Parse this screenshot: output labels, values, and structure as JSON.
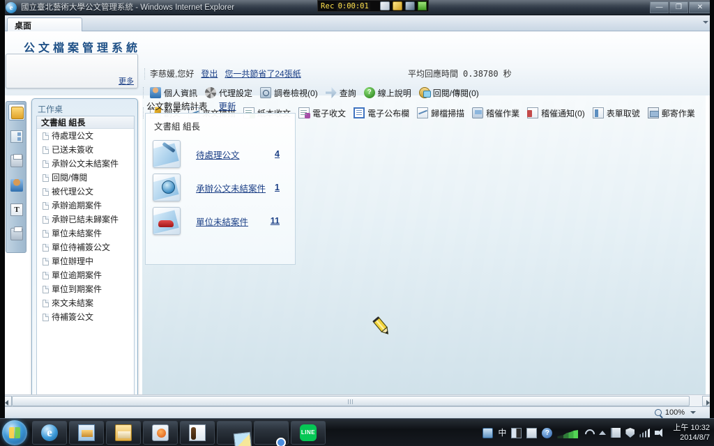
{
  "window": {
    "title": "國立臺北藝術大學公文管理系統 - Windows Internet Explorer",
    "browser_icon": "ie-logo-icon",
    "minimize_label": "—",
    "maximize_label": "❐",
    "close_label": "✕"
  },
  "recorder": {
    "label": "Rec",
    "time": "0:00:01",
    "tools": [
      "pen-tool-icon",
      "highlighter-tool-icon",
      "spray-tool-icon",
      "stop-record-icon"
    ]
  },
  "tabstrip": {
    "tab_label": "桌面"
  },
  "app_header": {
    "brand": "公文檔案管理系統",
    "greeting": "李慈媛,您好",
    "logout_label": "登出",
    "paper_saved": "您一共節省了24張紙",
    "response_label": "平均回應時間",
    "response_value": "0.38780",
    "response_unit": "秒"
  },
  "announcement": {
    "more_label": "更多"
  },
  "toolbar_row1": [
    {
      "label": "個人資訊",
      "icon": "person-icon"
    },
    {
      "label": "代理設定",
      "icon": "gear-icon"
    },
    {
      "label": "調卷檢視(0)",
      "icon": "magnifier-icon"
    },
    {
      "label": "查詢",
      "icon": "find-icon"
    },
    {
      "label": "線上說明",
      "icon": "help-circle-icon"
    },
    {
      "label": "回閱/傳閱(0)",
      "icon": "circulate-icon"
    }
  ],
  "toolbar_row2": [
    {
      "label": "創文",
      "icon": "compose-icon"
    },
    {
      "label": "來文掃描",
      "icon": "scan-incoming-icon"
    },
    {
      "label": "紙本收文",
      "icon": "paper-receive-icon"
    },
    {
      "label": "電子收文",
      "icon": "electronic-receive-icon"
    },
    {
      "label": "電子公布欄",
      "icon": "bulletin-board-icon"
    },
    {
      "label": "歸檔掃描",
      "icon": "archive-scan-icon"
    },
    {
      "label": "稽催作業",
      "icon": "audit-task-icon"
    },
    {
      "label": "稽催通知(0)",
      "icon": "audit-notify-icon"
    },
    {
      "label": "表單取號",
      "icon": "form-number-icon"
    },
    {
      "label": "郵寄作業",
      "icon": "mail-task-icon"
    }
  ],
  "icon_rail": [
    {
      "name": "folder-icon",
      "selected": true
    },
    {
      "name": "org-chart-icon",
      "selected": false
    },
    {
      "name": "printer-icon",
      "selected": false
    },
    {
      "name": "person-icon",
      "selected": false
    },
    {
      "name": "text-tool-icon",
      "selected": false
    },
    {
      "name": "fax-icon",
      "selected": false
    }
  ],
  "sidebar": {
    "title": "工作桌",
    "group": "文書組 組長",
    "items": [
      "待處理公文",
      "已送未簽收",
      "承辦公文未結案件",
      "回閱/傳閱",
      "被代理公文",
      "承辦逾期案件",
      "承辦已結未歸案件",
      "單位未結案件",
      "單位待補簽公文",
      "單位辦理中",
      "單位逾期案件",
      "單位到期案件",
      "來文未結案",
      "待補簽公文"
    ]
  },
  "main": {
    "heading": "公文數量統計表",
    "refresh_label": "更新",
    "group_label": "文書組 組長",
    "stats": [
      {
        "label": "待處理公文",
        "count": "4",
        "icon": "pen-doc-icon"
      },
      {
        "label": "承辦公文未結案件",
        "count": "1",
        "icon": "clock-doc-icon"
      },
      {
        "label": "單位未結案件",
        "count": "11",
        "icon": "car-doc-icon"
      }
    ]
  },
  "statusbar": {
    "zoom_label": "100%",
    "zoom_icon": "zoom-magnifier-icon"
  },
  "taskbar": {
    "start_label": "start-orb-icon",
    "buttons": [
      "internet-explorer-icon",
      "photo-gallery-icon",
      "file-explorer-icon",
      "media-player-icon",
      "guitar-app-icon",
      "notes-app-icon",
      "google-chrome-icon",
      "line-messenger-icon"
    ],
    "tray": [
      "ime-status-icon",
      "chinese-input-icon",
      "halfwidth-icon",
      "ime-menu-icon",
      "help-icon",
      "network-graph-icon",
      "wifi-icon",
      "show-hidden-icons-icon",
      "flag-action-center-icon",
      "security-shield-icon",
      "signal-bars-icon",
      "volume-icon"
    ],
    "tray_cn_label": "中",
    "clock_time": "上午 10:32",
    "clock_date": "2014/8/7"
  },
  "cursor": {
    "type": "pencil-cursor"
  }
}
